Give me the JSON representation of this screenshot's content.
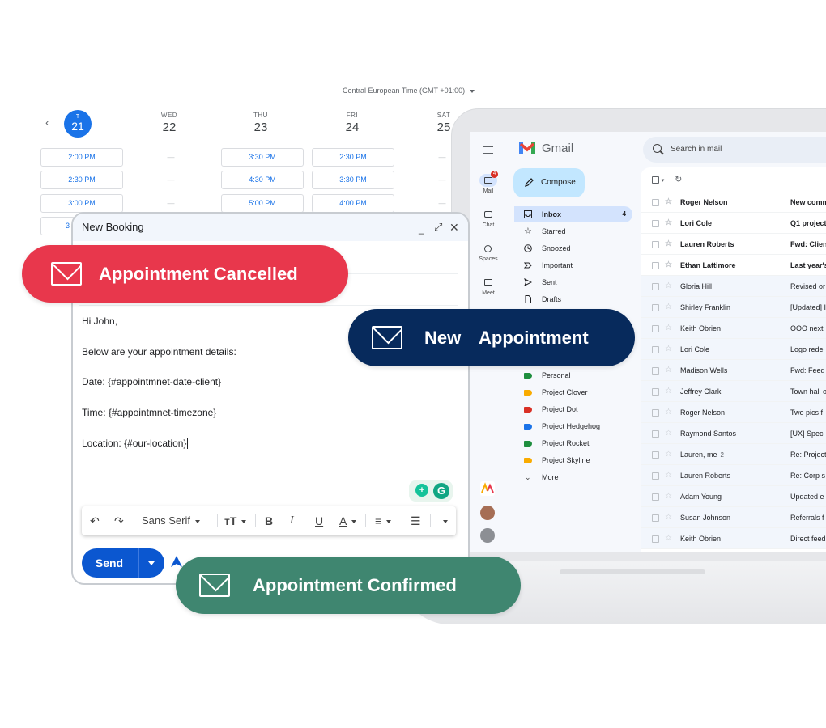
{
  "calendar": {
    "timezone": "Central European Time (GMT +01:00)",
    "prev_icon": "chevron-left-icon",
    "days": [
      {
        "dow": "T",
        "dom": "21",
        "today": true
      },
      {
        "dow": "WED",
        "dom": "22"
      },
      {
        "dow": "THU",
        "dom": "23"
      },
      {
        "dow": "FRI",
        "dom": "24"
      },
      {
        "dow": "SAT",
        "dom": "25"
      }
    ],
    "slots": {
      "tue": [
        "2:00 PM",
        "2:30 PM",
        "3:00 PM",
        "3"
      ],
      "thu": [
        "3:30 PM",
        "4:30 PM",
        "5:00 PM"
      ],
      "fri": [
        "2:30 PM",
        "3:30 PM",
        "4:00 PM"
      ],
      "dash": "—"
    }
  },
  "gmail": {
    "title": "Gmail",
    "search_placeholder": "Search in mail",
    "compose_label": "Compose",
    "rail": [
      {
        "label": "Mail",
        "badge": "4"
      },
      {
        "label": "Chat"
      },
      {
        "label": "Spaces"
      },
      {
        "label": "Meet"
      }
    ],
    "nav": [
      {
        "label": "Inbox",
        "count": "4"
      },
      {
        "label": "Starred"
      },
      {
        "label": "Snoozed"
      },
      {
        "label": "Important"
      },
      {
        "label": "Sent"
      },
      {
        "label": "Drafts"
      }
    ],
    "labels": [
      {
        "label": "Personal",
        "color": "#1e8e3e"
      },
      {
        "label": "Project Clover",
        "color": "#f9ab00"
      },
      {
        "label": "Project Dot",
        "color": "#d93025"
      },
      {
        "label": "Project Hedgehog",
        "color": "#1a73e8"
      },
      {
        "label": "Project Rocket",
        "color": "#1e8e3e"
      },
      {
        "label": "Project Skyline",
        "color": "#f9ab00"
      }
    ],
    "more_label": "More",
    "emails": [
      {
        "sender": "Roger Nelson",
        "subject": "New comm",
        "unread": true
      },
      {
        "sender": "Lori Cole",
        "subject": "Q1 project",
        "unread": true
      },
      {
        "sender": "Lauren Roberts",
        "subject": "Fwd: Clien",
        "unread": true
      },
      {
        "sender": "Ethan Lattimore",
        "subject": "Last year's",
        "unread": true
      },
      {
        "sender": "Gloria Hill",
        "subject": "Revised or",
        "unread": false
      },
      {
        "sender": "Shirley Franklin",
        "subject": "[Updated] I",
        "unread": false
      },
      {
        "sender": "Keith Obrien",
        "subject": "OOO next",
        "unread": false
      },
      {
        "sender": "Lori Cole",
        "subject": "Logo rede",
        "unread": false
      },
      {
        "sender": "Madison Wells",
        "subject": "Fwd: Feed",
        "unread": false
      },
      {
        "sender": "Jeffrey Clark",
        "subject": "Town hall o",
        "unread": false
      },
      {
        "sender": "Roger Nelson",
        "subject": "Two pics f",
        "unread": false
      },
      {
        "sender": "Raymond Santos",
        "subject": "[UX] Spec",
        "unread": false
      },
      {
        "sender": "Lauren, me",
        "thread": "2",
        "subject": "Re: Project",
        "unread": false
      },
      {
        "sender": "Lauren Roberts",
        "subject": "Re: Corp s",
        "unread": false
      },
      {
        "sender": "Adam Young",
        "subject": "Updated e",
        "unread": false
      },
      {
        "sender": "Susan Johnson",
        "subject": "Referrals f",
        "unread": false
      },
      {
        "sender": "Keith Obrien",
        "subject": "Direct feed",
        "unread": false
      }
    ]
  },
  "compose_window": {
    "title": "New Booking",
    "body": [
      "Hi John,",
      "Below are your appointment details:",
      "Date: {#appointmnet-date-client}",
      "Time:  {#appointmnet-timezone}",
      "Location:  {#our-location}"
    ],
    "font_name": "Sans Serif",
    "send_label": "Send",
    "ext_a": "+",
    "ext_b": "G"
  },
  "pills": {
    "cancelled": "Appointment Cancelled",
    "new_word1": "New",
    "new_word2": "Appointment",
    "confirmed": "Appointment Confirmed"
  },
  "colors": {
    "cancelled": "#e8374c",
    "new": "#072a5c",
    "confirmed": "#3f8670",
    "accent": "#1a73e8"
  }
}
